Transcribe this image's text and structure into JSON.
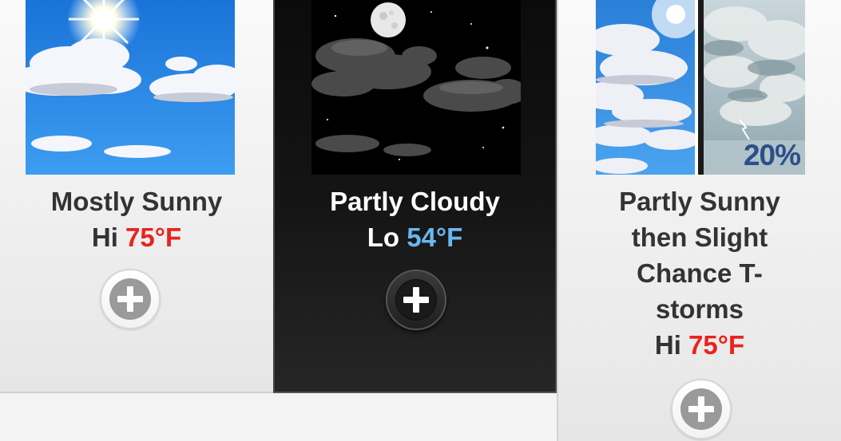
{
  "forecast": [
    {
      "condition": "Mostly Sunny",
      "temp_label": "Hi",
      "temp_value": "75°F",
      "temp_color": "#e8231f",
      "icon": "mostly-sunny-icon",
      "button_icon": "plus-icon"
    },
    {
      "condition": "Partly Cloudy",
      "temp_label": "Lo",
      "temp_value": "54°F",
      "temp_color": "#6ab7ef",
      "icon": "partly-cloudy-night-icon",
      "button_icon": "plus-icon",
      "selected": true
    },
    {
      "condition_lines": [
        "Partly Sunny",
        "then Slight",
        "Chance T-",
        "storms"
      ],
      "temp_label": "Hi",
      "temp_value": "75°F",
      "temp_color": "#e8231f",
      "icon": "partly-sunny-then-tstorms-icon",
      "precip_chance": "20%",
      "button_icon": "plus-icon"
    }
  ],
  "colors": {
    "dark_panel": "#141414",
    "light_panel": "#eeeeee",
    "sky_blue": "#1e88e5"
  }
}
